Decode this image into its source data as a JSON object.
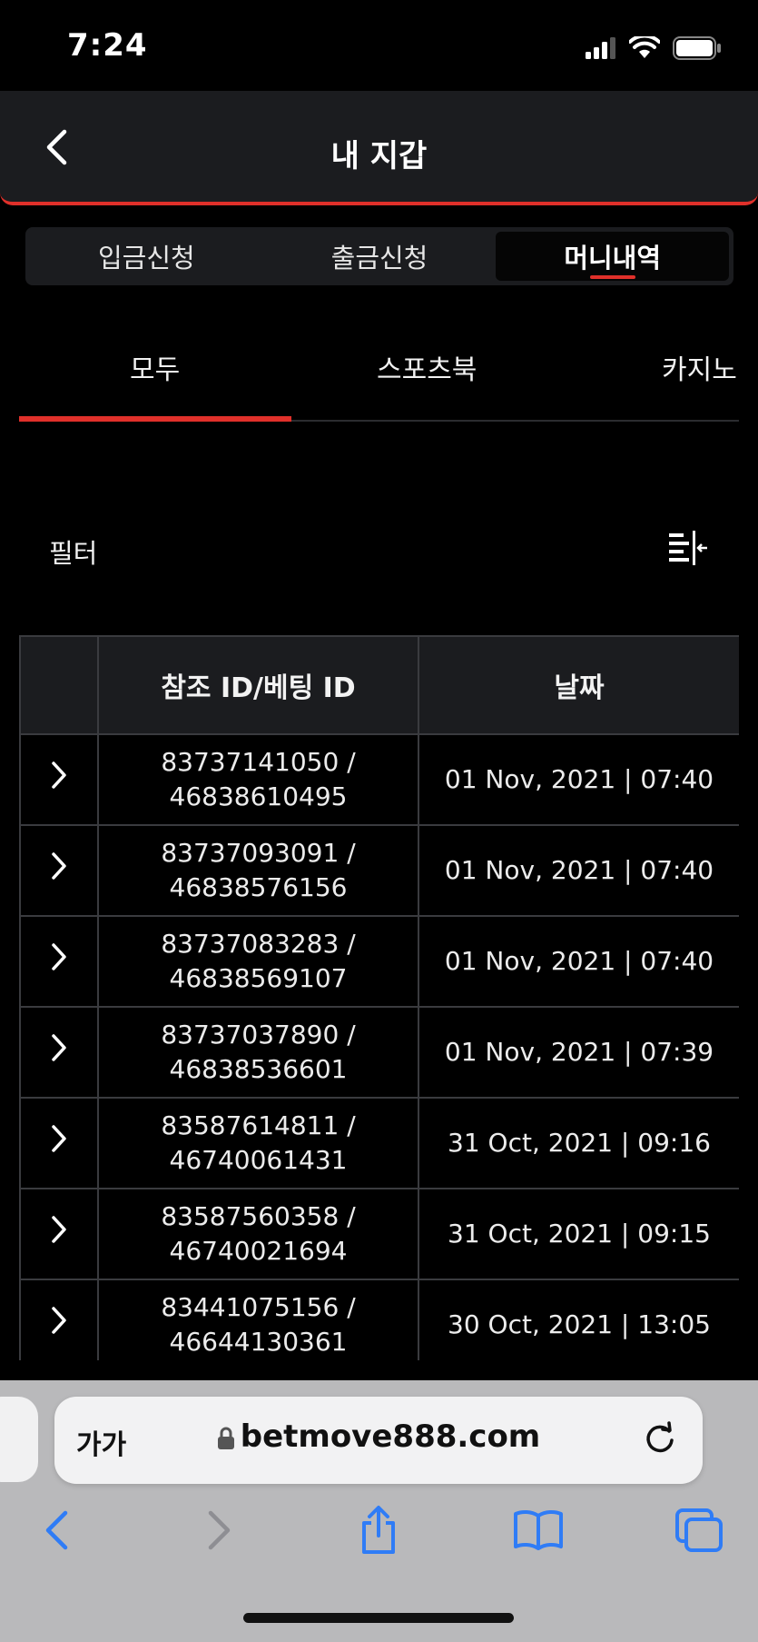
{
  "status": {
    "time": "7:24"
  },
  "header": {
    "title": "내 지갑"
  },
  "segments": [
    {
      "label": "입금신청",
      "active": false
    },
    {
      "label": "출금신청",
      "active": false
    },
    {
      "label": "머니내역",
      "active": true
    }
  ],
  "categories": [
    {
      "label": "모두",
      "active": true
    },
    {
      "label": "스포츠북",
      "active": false
    },
    {
      "label": "카지노",
      "active": false
    }
  ],
  "filter": {
    "label": "필터"
  },
  "table": {
    "headers": [
      "",
      "참조 ID/베팅 ID",
      "날짜"
    ],
    "rows": [
      {
        "ref": "83737141050 /",
        "bet": "46838610495",
        "date": "01 Nov, 2021 | 07:40"
      },
      {
        "ref": "83737093091 /",
        "bet": "46838576156",
        "date": "01 Nov, 2021 | 07:40"
      },
      {
        "ref": "83737083283 /",
        "bet": "46838569107",
        "date": "01 Nov, 2021 | 07:40"
      },
      {
        "ref": "83737037890 /",
        "bet": "46838536601",
        "date": "01 Nov, 2021 | 07:39"
      },
      {
        "ref": "83587614811 /",
        "bet": "46740061431",
        "date": "31 Oct, 2021 | 09:16"
      },
      {
        "ref": "83587560358 /",
        "bet": "46740021694",
        "date": "31 Oct, 2021 | 09:15"
      },
      {
        "ref": "83441075156 /",
        "bet": "46644130361",
        "date": "30 Oct, 2021 | 13:05"
      }
    ]
  },
  "browser": {
    "aa_label": "가가",
    "url": "betmove888.com"
  },
  "colors": {
    "accent": "#e0302a",
    "surface": "#1b1c1f",
    "ios_blue": "#2f7cf6"
  }
}
